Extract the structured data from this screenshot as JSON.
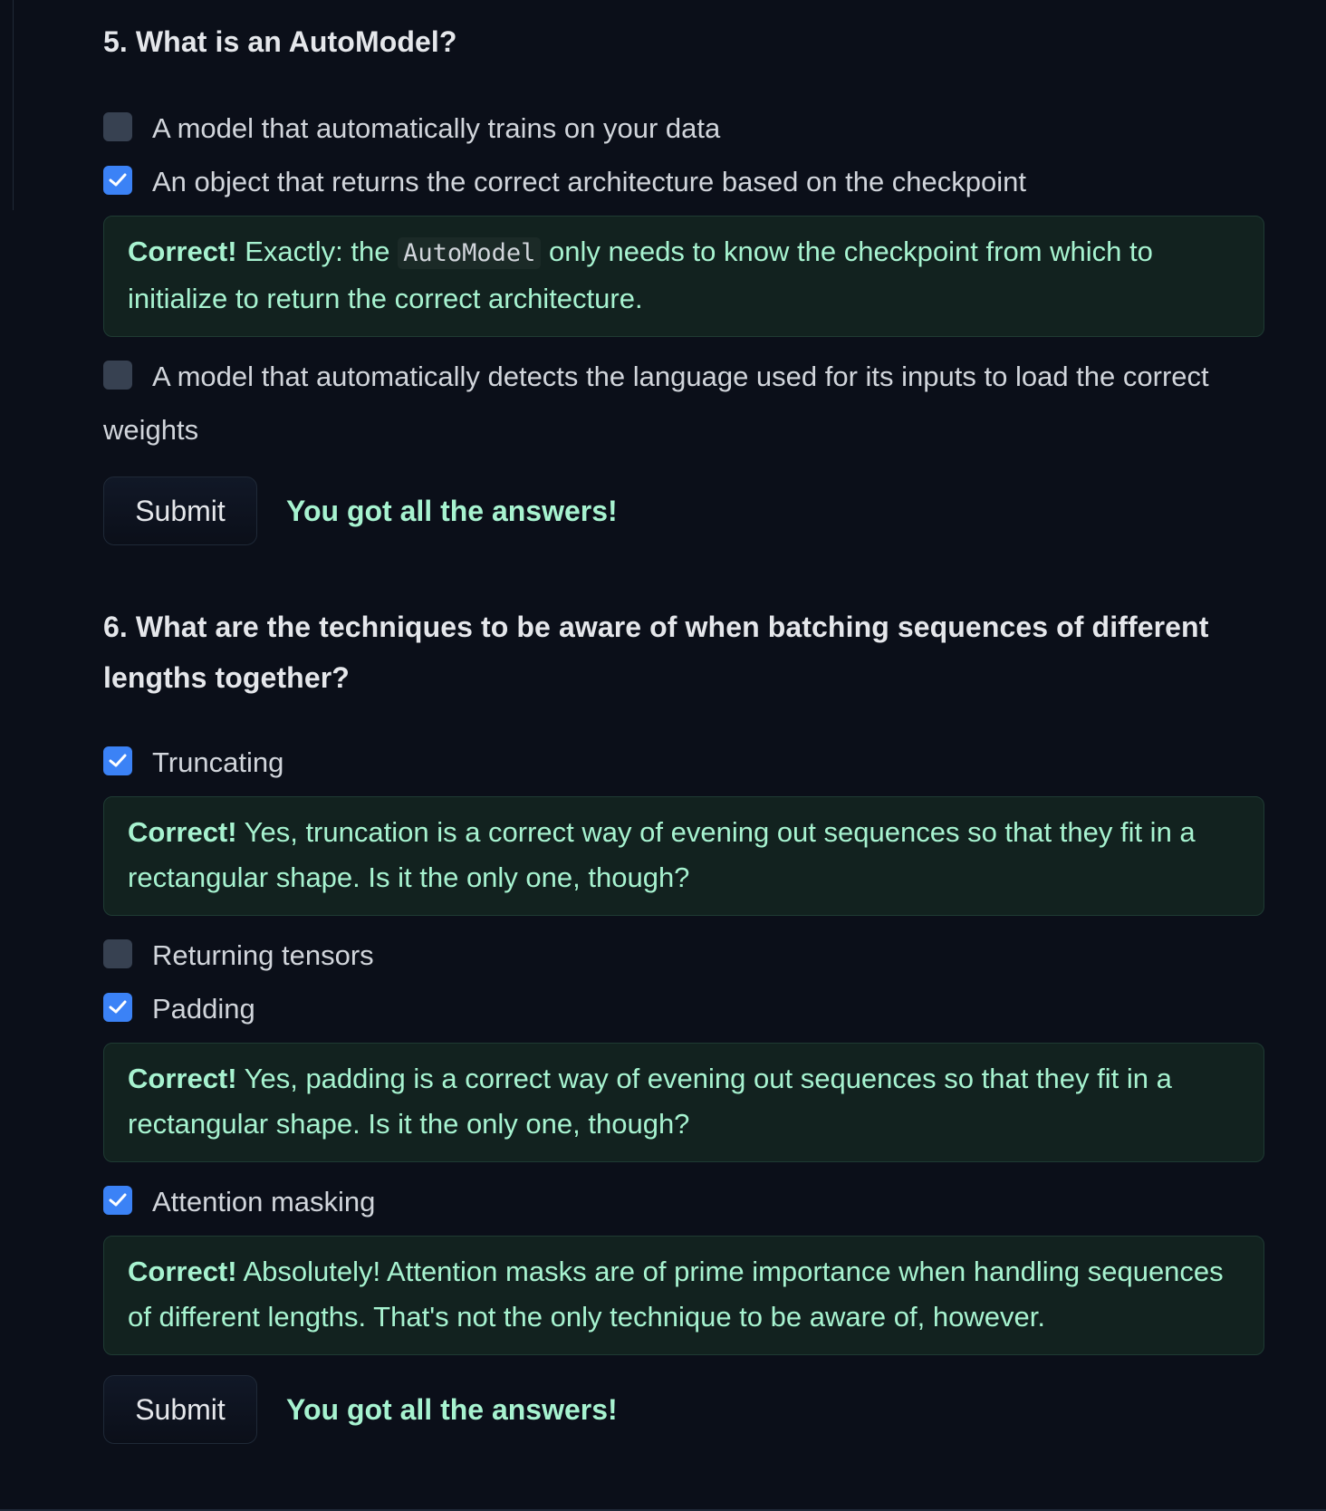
{
  "questions": [
    {
      "title": "5. What is an AutoModel?",
      "options": [
        {
          "label": "A model that automatically trains on your data",
          "checked": false
        },
        {
          "label": "An object that returns the correct architecture based on the checkpoint",
          "checked": true,
          "feedback": {
            "prefix": "Correct!",
            "text_before_code": " Exactly: the ",
            "code": "AutoModel",
            "text_after_code": " only needs to know the checkpoint from which to initialize to return the correct architecture."
          }
        },
        {
          "label": "A model that automatically detects the language used for its inputs to load the correct weights",
          "checked": false
        }
      ],
      "submit_label": "Submit",
      "result": "You got all the answers!"
    },
    {
      "title": "6. What are the techniques to be aware of when batching sequences of different lengths together?",
      "options": [
        {
          "label": "Truncating",
          "checked": true,
          "feedback": {
            "prefix": "Correct!",
            "text": " Yes, truncation is a correct way of evening out sequences so that they fit in a rectangular shape. Is it the only one, though?"
          }
        },
        {
          "label": "Returning tensors",
          "checked": false
        },
        {
          "label": "Padding",
          "checked": true,
          "feedback": {
            "prefix": "Correct!",
            "text": " Yes, padding is a correct way of evening out sequences so that they fit in a rectangular shape. Is it the only one, though?"
          }
        },
        {
          "label": "Attention masking",
          "checked": true,
          "feedback": {
            "prefix": "Correct!",
            "text": " Absolutely! Attention masks are of prime importance when handling sequences of different lengths. That's not the only technique to be aware of, however."
          }
        }
      ],
      "submit_label": "Submit",
      "result": "You got all the answers!"
    }
  ],
  "colors": {
    "background": "#0b0f19",
    "checkbox_checked": "#3b82f6",
    "checkbox_unchecked": "#374151",
    "feedback_bg": "#12221f",
    "success_text": "#a7f3d0"
  },
  "icons": {
    "checkmark": "check-icon"
  }
}
